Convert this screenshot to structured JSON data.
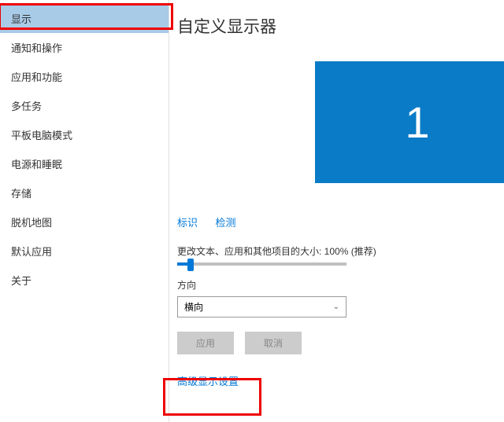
{
  "sidebar": {
    "items": [
      {
        "label": "显示",
        "active": true
      },
      {
        "label": "通知和操作"
      },
      {
        "label": "应用和功能"
      },
      {
        "label": "多任务"
      },
      {
        "label": "平板电脑模式"
      },
      {
        "label": "电源和睡眠"
      },
      {
        "label": "存储"
      },
      {
        "label": "脱机地图"
      },
      {
        "label": "默认应用"
      },
      {
        "label": "关于"
      }
    ]
  },
  "main": {
    "title": "自定义显示器",
    "monitor_number": "1",
    "links": {
      "identify": "标识",
      "detect": "检测"
    },
    "scaling": {
      "label": "更改文本、应用和其他项目的大小: 100% (推荐)"
    },
    "orientation": {
      "label": "方向",
      "value": "横向"
    },
    "buttons": {
      "apply": "应用",
      "cancel": "取消"
    },
    "advanced": "高级显示设置"
  }
}
